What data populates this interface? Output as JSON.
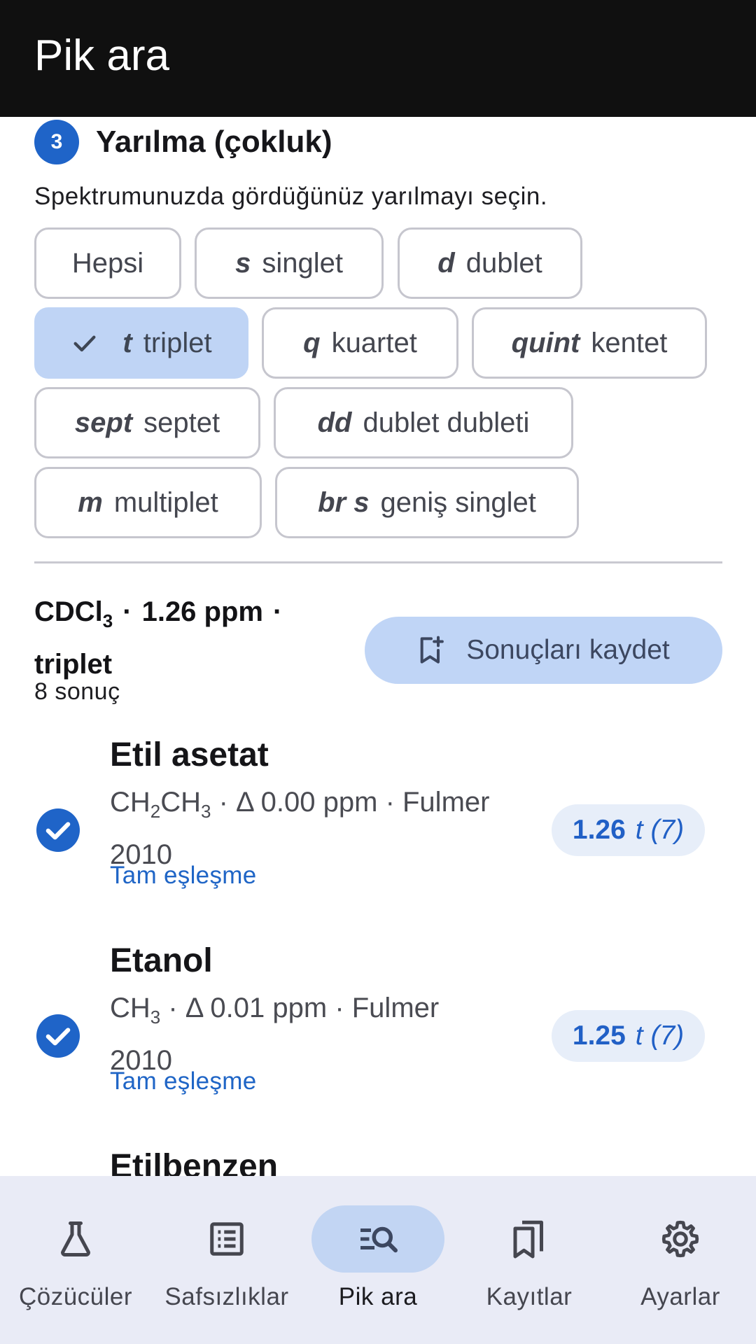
{
  "appbar": {
    "title": "Pik ara"
  },
  "section": {
    "step_number": "3",
    "title": "Yarılma (çokluk)",
    "hint": "Spektrumunuzda gördüğünüz yarılmayı seçin."
  },
  "chips": [
    {
      "abbr": "",
      "label": "Hepsi",
      "selected": false
    },
    {
      "abbr": "s",
      "label": "singlet",
      "selected": false
    },
    {
      "abbr": "d",
      "label": "dublet",
      "selected": false
    },
    {
      "abbr": "t",
      "label": "triplet",
      "selected": true
    },
    {
      "abbr": "q",
      "label": "kuartet",
      "selected": false
    },
    {
      "abbr": "quint",
      "label": "kentet",
      "selected": false
    },
    {
      "abbr": "sept",
      "label": "septet",
      "selected": false
    },
    {
      "abbr": "dd",
      "label": "dublet dubleti",
      "selected": false
    },
    {
      "abbr": "m",
      "label": "multiplet",
      "selected": false
    },
    {
      "abbr": "br s",
      "label": "geniş singlet",
      "selected": false
    }
  ],
  "summary": {
    "solvent_prefix": "CDCl",
    "solvent_sub": "3",
    "shift": "1.26 ppm",
    "multiplicity": "triplet",
    "count": "8 sonuç"
  },
  "save_button": {
    "label": "Sonuçları kaydet",
    "icon": "bookmark-add-icon"
  },
  "results": [
    {
      "name": "Etil asetat",
      "meta_parts": [
        "CH",
        "2",
        "CH",
        "3",
        " · Δ 0.00 ppm · Fulmer 2010"
      ],
      "match": "Tam eşleşme",
      "value": "1.26",
      "mult": "t (7)",
      "checked": true
    },
    {
      "name": "Etanol",
      "meta_parts": [
        "CH",
        "3",
        " · Δ 0.01 ppm · Fulmer 2010"
      ],
      "match": "Tam eşleşme",
      "value": "1.25",
      "mult": "t (7)",
      "checked": true
    },
    {
      "name": "Etilbenzen",
      "partial": true
    }
  ],
  "nav": {
    "items": [
      {
        "label": "Çözücüler",
        "icon": "flask-icon",
        "active": false
      },
      {
        "label": "Safsızlıklar",
        "icon": "list-icon",
        "active": false
      },
      {
        "label": "Pik ara",
        "icon": "search-list-icon",
        "active": true
      },
      {
        "label": "Kayıtlar",
        "icon": "bookmarks-icon",
        "active": false
      },
      {
        "label": "Ayarlar",
        "icon": "settings-icon",
        "active": false
      }
    ]
  },
  "colors": {
    "accent": "#1f64c8",
    "chip_selected": "#bfd4f5",
    "nav_bg": "#e9ebf6"
  }
}
